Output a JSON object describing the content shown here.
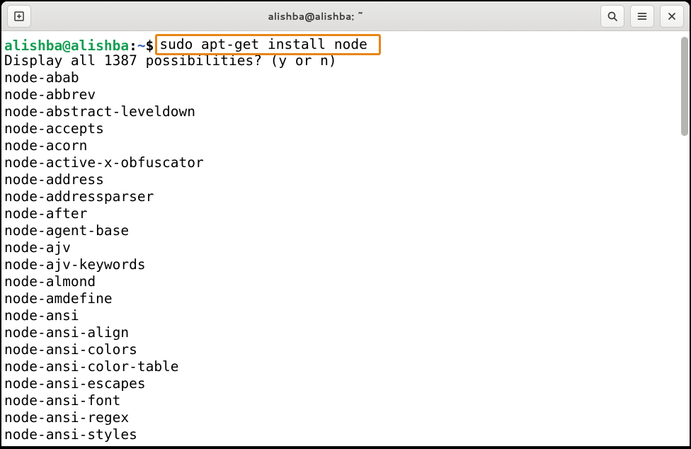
{
  "window": {
    "title": "alishba@alishba: ~"
  },
  "prompt": {
    "user_host": "alishba@alishba",
    "colon": ":",
    "path": "~",
    "dollar": "$"
  },
  "command": "sudo apt-get install node ",
  "output_display_line": "Display all 1387 possibilities? (y or n)",
  "packages": [
    "node-abab",
    "node-abbrev",
    "node-abstract-leveldown",
    "node-accepts",
    "node-acorn",
    "node-active-x-obfuscator",
    "node-address",
    "node-addressparser",
    "node-after",
    "node-agent-base",
    "node-ajv",
    "node-ajv-keywords",
    "node-almond",
    "node-amdefine",
    "node-ansi",
    "node-ansi-align",
    "node-ansi-colors",
    "node-ansi-color-table",
    "node-ansi-escapes",
    "node-ansi-font",
    "node-ansi-regex",
    "node-ansi-styles"
  ]
}
